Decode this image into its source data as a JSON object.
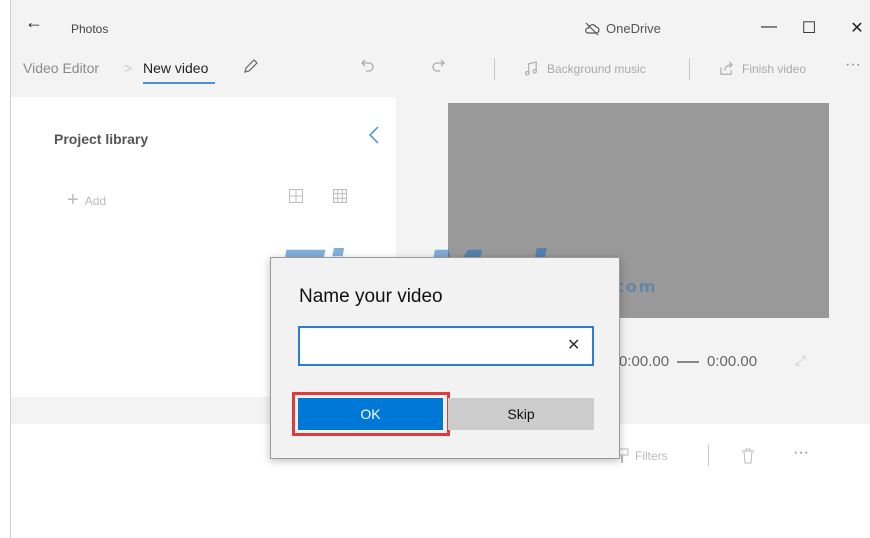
{
  "titlebar": {
    "back_glyph": "←",
    "app_name": "Photos",
    "onedrive_label": "OneDrive",
    "minimize_glyph": "—",
    "maximize_glyph": "☐",
    "close_glyph": "✕"
  },
  "toolbar": {
    "crumbs": [
      "Video Editor",
      "New video"
    ],
    "crumb_separator": ">",
    "background_music_label": "Background music",
    "finish_video_label": "Finish video",
    "more_glyph": "···"
  },
  "library": {
    "title": "Project library",
    "add_label": "Add"
  },
  "player": {
    "current_time": "0:00.00",
    "total_time": "0:00.00"
  },
  "storyboard": {
    "filters_label": "Filters",
    "more_glyph": "···"
  },
  "watermark": {
    "brand": "TipsMake",
    "suffix": ".com"
  },
  "dialog": {
    "heading": "Name your video",
    "input_value": "",
    "ok_label": "OK",
    "skip_label": "Skip"
  },
  "colors": {
    "accent": "#0078d7",
    "highlight": "#e03a3a",
    "preview_gray": "#999999"
  }
}
